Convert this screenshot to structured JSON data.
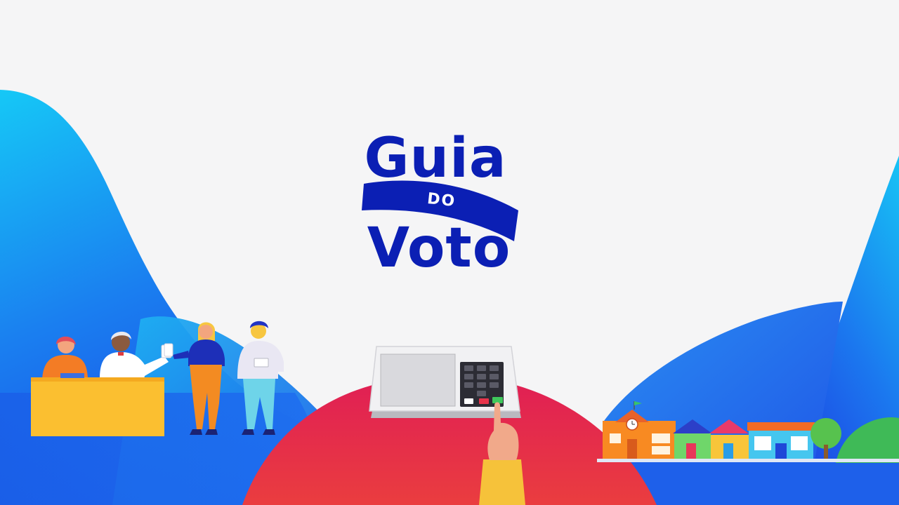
{
  "logo": {
    "line1": "Guia",
    "ribbon": "DO",
    "line2": "Voto"
  },
  "colors": {
    "background": "#f5f5f6",
    "brand_blue": "#0b1fb4",
    "hill_cyan": "#13b7f2",
    "hill_blue": "#1f5fea",
    "dome_red": "#e2264f",
    "desk_yellow": "#fbbf30"
  },
  "ballot_box_keys": {
    "confirm": "green",
    "correct": "red"
  }
}
